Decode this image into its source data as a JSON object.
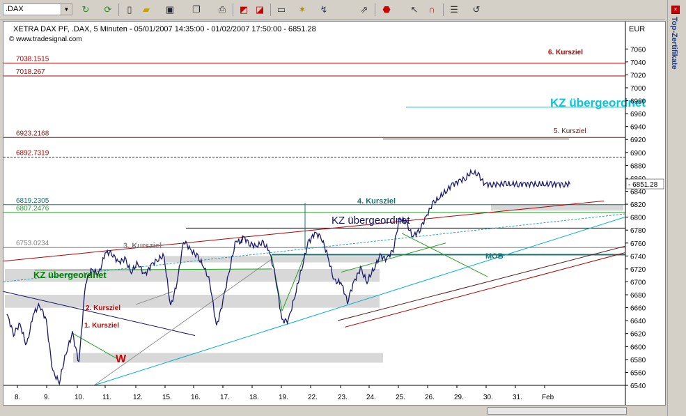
{
  "toolbar": {
    "symbol": ".DAX",
    "buttons": [
      "refresh-icon",
      "reload-icon",
      "new-icon",
      "open-icon",
      "save-icon",
      "copy-icon",
      "print-icon",
      "chart-icon",
      "chart2-icon",
      "window-icon",
      "sparkle-icon",
      "draw-icon",
      "export-icon",
      "stop-icon",
      "pointer-icon",
      "magnet-icon",
      "properties-icon",
      "undo-icon"
    ]
  },
  "sidebar": {
    "label": "Top-Zertifikate"
  },
  "chart_header": {
    "title": "XETRA DAX PF, .DAX, 5 Minuten - 05/01/2007 14:35:00 - 01/02/2007 17:50:00 - 6851.28",
    "source": "© www.tradesignal.com",
    "currency": "EUR",
    "last_price": "6851.28"
  },
  "chart_data": {
    "type": "line",
    "title": "XETRA DAX PF, .DAX, 5 Minuten - 05/01/2007 14:35:00 - 01/02/2007 17:50:00 - 6851.28",
    "x_ticks": [
      "8.",
      "9.",
      "10.",
      "11.",
      "12.",
      "15.",
      "16.",
      "17.",
      "18.",
      "19.",
      "22.",
      "23.",
      "24.",
      "25.",
      "26.",
      "29.",
      "30.",
      "31.",
      "Feb"
    ],
    "y_ticks": [
      6540,
      6560,
      6580,
      6600,
      6620,
      6640,
      6660,
      6680,
      6700,
      6720,
      6740,
      6760,
      6780,
      6800,
      6820,
      6840,
      6860,
      6880,
      6900,
      6920,
      6940,
      6960,
      6980,
      7000,
      7020,
      7040,
      7060
    ],
    "ylim": [
      6540,
      7070
    ],
    "ylabel": "EUR",
    "series": [
      {
        "x": [
          0,
          0.5,
          1,
          1.5,
          2,
          2.5,
          3,
          3.5,
          4,
          4.5,
          5,
          5.5,
          6,
          6.5,
          7,
          7.5,
          8,
          8.5,
          9,
          9.5,
          10,
          10.5,
          11,
          11.5,
          12,
          12.5,
          13,
          13.5,
          14,
          14.5,
          15,
          15.5,
          16,
          16.5,
          17,
          17.5,
          17.9
        ],
        "values": [
          6650,
          6620,
          6635,
          6600,
          6650,
          6665,
          6640,
          6560,
          6545,
          6590,
          6620,
          6575,
          6700,
          6720,
          6710,
          6745,
          6745,
          6730,
          6735,
          6715,
          6730,
          6710,
          6725,
          6735,
          6740,
          6660,
          6700,
          6765,
          6750,
          6740,
          6725,
          6700,
          6630,
          6670,
          6720,
          6765,
          6760
        ],
        "color": "#1a1a6e"
      },
      {
        "x": [
          14.5,
          15,
          15.5,
          16,
          16.5,
          17,
          17.5,
          18,
          18.5,
          19,
          19.5,
          20,
          20.5,
          21,
          21.5,
          22,
          22.5,
          23,
          23.5,
          24,
          24.5,
          25,
          25.5,
          26,
          26.5,
          27,
          27.5,
          28,
          28.5,
          29,
          29.5,
          30,
          30.5,
          31,
          31.5,
          32,
          32.5,
          33,
          33.5,
          34,
          34.5,
          35,
          35.5,
          36,
          36.5,
          37,
          37.5,
          38,
          38.5,
          39,
          39.5,
          40,
          40.5,
          41,
          41.5,
          42,
          42.5,
          43,
          43.5,
          44
        ],
        "values": [
          6725,
          6700,
          6640,
          6660,
          6700,
          6760,
          6770,
          6770,
          6760,
          6755,
          6760,
          6750,
          6710,
          6640,
          6640,
          6680,
          6720,
          6760,
          6775,
          6770,
          6740,
          6700,
          6700,
          6670,
          6700,
          6720,
          6700,
          6720,
          6740,
          6735,
          6750,
          6800,
          6790,
          6770,
          6780,
          6800,
          6820,
          6830,
          6840,
          6850,
          6855,
          6860,
          6870,
          6865,
          6851,
          6851,
          6851,
          6851,
          6851,
          6851,
          6851,
          6851,
          6851,
          6851,
          6851,
          6851,
          6851,
          6851,
          6851,
          6851
        ]
      }
    ],
    "levels": [
      {
        "label": "7038.1515",
        "value": 7038.1515
      },
      {
        "label": "7018.267",
        "value": 7018.267
      },
      {
        "label": "6923.2168",
        "value": 6923.2168
      },
      {
        "label": "6892.7319",
        "value": 6892.7319
      },
      {
        "label": "6819.2305",
        "value": 6819.2305
      },
      {
        "label": "6807.2476",
        "value": 6807.2476
      },
      {
        "label": "6753.0234",
        "value": 6753.0234
      }
    ],
    "annotations": [
      {
        "text": "6. Kursziel",
        "color": "#b00000"
      },
      {
        "text": "KZ übergeordnet",
        "color": "#00c8e0"
      },
      {
        "text": "5. Kursziel",
        "color": "#5a1a1a"
      },
      {
        "text": "4. Kursziel",
        "color": "#1a7070"
      },
      {
        "text": "KZ übergeordnet",
        "color": "#101070"
      },
      {
        "text": "3. Kursziel",
        "color": "#808080"
      },
      {
        "text": "KZ übergeordnet",
        "color": "#008000"
      },
      {
        "text": "2. Kursziel",
        "color": "#c00000"
      },
      {
        "text": "1. Kursziel",
        "color": "#c00000"
      },
      {
        "text": "MOB",
        "color": "#1a7070"
      },
      {
        "text": "W",
        "color": "#d00000"
      }
    ]
  }
}
